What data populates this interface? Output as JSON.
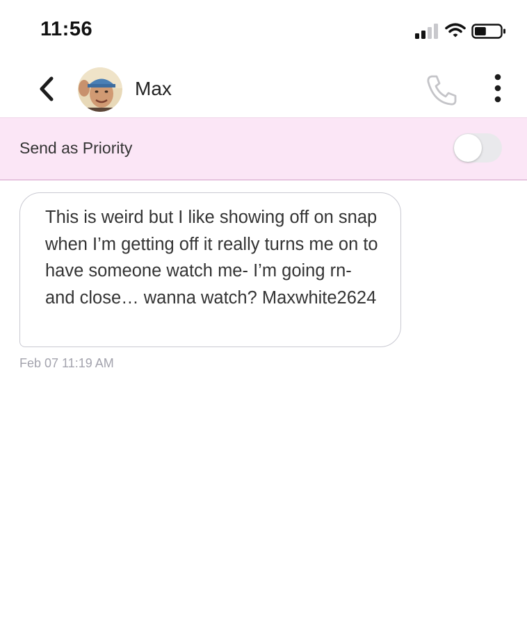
{
  "status_bar": {
    "time": "11:56",
    "signal_icon": "cellular-signal-icon",
    "wifi_icon": "wifi-icon",
    "battery_icon": "battery-icon",
    "signal_bars_filled": 2,
    "signal_bars_total": 4,
    "battery_level": 0.45
  },
  "header": {
    "back_icon": "chevron-left-icon",
    "contact_name": "Max",
    "call_icon": "phone-icon",
    "more_icon": "more-vertical-icon"
  },
  "priority": {
    "label": "Send as Priority",
    "enabled": false
  },
  "messages": [
    {
      "text": "This is weird but I like showing off on snap when I’m getting off it really turns me on to have someone watch me- I’m going rn- and close… wanna watch? Maxwhite2624",
      "timestamp": "Feb 07 11:19 AM",
      "direction": "incoming"
    }
  ],
  "colors": {
    "priority_background": "#fbe6f6",
    "priority_border": "#e6c3de",
    "bubble_border": "#c9c9d2",
    "timestamp": "#a3a3ad",
    "toggle_off": "#e9e9ec",
    "call_icon": "#c4c4c8"
  }
}
